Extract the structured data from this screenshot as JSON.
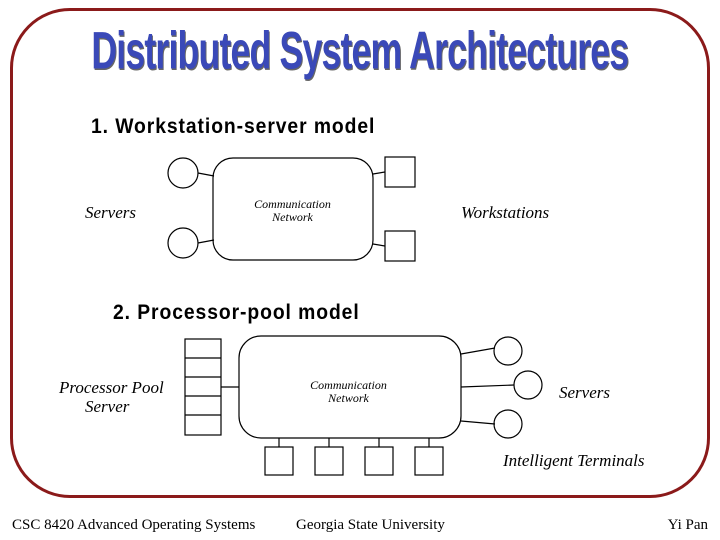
{
  "title": "Distributed System Architectures",
  "section1": {
    "heading": "1. Workstation-server model",
    "left_label": "Servers",
    "right_label": "Workstations",
    "box_line1": "Communication",
    "box_line2": "Network"
  },
  "section2": {
    "heading": "2. Processor-pool model",
    "left_label_line1": "Processor Pool",
    "left_label_line2": "Server",
    "box_line1": "Communication",
    "box_line2": "Network",
    "right_label": "Servers",
    "bottom_label": "Intelligent Terminals"
  },
  "footer": {
    "left": "CSC 8420 Advanced Operating Systems",
    "center": "Georgia State University",
    "right": "Yi Pan"
  }
}
